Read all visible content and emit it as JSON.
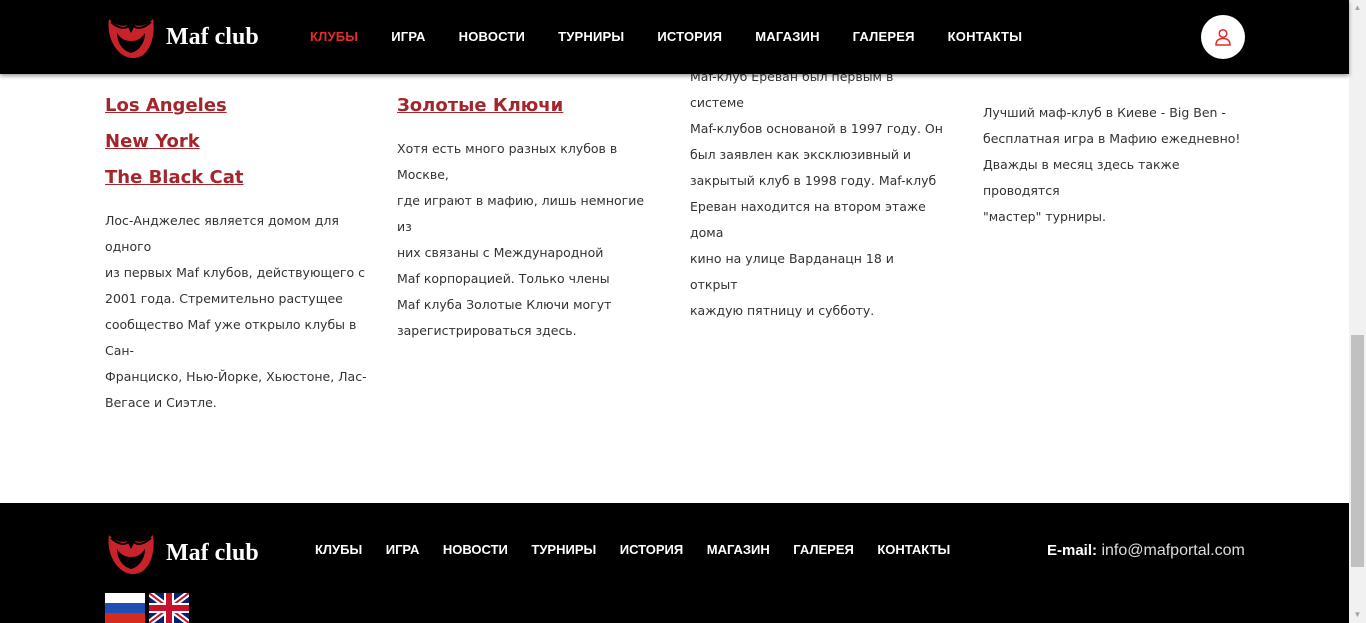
{
  "header": {
    "brand": "Maf club",
    "nav": [
      "КЛУБЫ",
      "ИГРА",
      "НОВОСТИ",
      "ТУРНИРЫ",
      "ИСТОРИЯ",
      "МАГАЗИН",
      "ГАЛЕРЕЯ",
      "КОНТАКТЫ"
    ],
    "active_nav": "КЛУБЫ"
  },
  "content": {
    "col1": {
      "links": [
        "Los Angeles",
        "New York",
        "The Black Cat"
      ],
      "desc_lines": [
        "Лос-Анджелес является домом для одного",
        "из первых Maf клубов, действующего с",
        "2001 года. Стремительно растущее",
        "сообщество Maf уже открыло клубы в Сан-",
        "Франциско, Нью-Йорке, Хьюстоне, Лас-",
        "Вегасе и Сиэтле."
      ]
    },
    "col2": {
      "title": "Золотые Ключи",
      "desc_lines": [
        "Хотя есть много разных клубов в Москве,",
        "где играют в мафию, лишь немногие из",
        "них связаны с Международной",
        "Maf корпорацией. Только члены",
        "Maf клуба Золотые Ключи могут",
        "зарегистрироваться здесь."
      ]
    },
    "col3": {
      "desc_lines": [
        "Maf-клуб Ереван был первым в системе",
        "Maf-клубов основаной в 1997 году. Он",
        "был заявлен как эксклюзивный и",
        "закрытый клуб в 1998 году. Maf-клуб",
        "Ереван находится на втором этаже дома",
        "кино на улице Варданацн 18 и открыт",
        "каждую пятницу и субботу."
      ]
    },
    "col4": {
      "desc_lines": [
        "Лучший маф-клуб в Киеве - Big Ben -",
        "бесплатная игра в Мафию ежедневно!",
        "Дважды в месяц здесь также проводятся",
        "\"мастер\" турниры."
      ]
    }
  },
  "footer": {
    "brand": "Maf club",
    "nav": [
      "КЛУБЫ",
      "ИГРА",
      "НОВОСТИ",
      "ТУРНИРЫ",
      "ИСТОРИЯ",
      "МАГАЗИН",
      "ГАЛЕРЕЯ",
      "КОНТАКТЫ"
    ],
    "email_label": "E-mail:",
    "email_value": "info@mafportal.com",
    "flags": [
      "ru-flag-icon",
      "uk-flag-icon"
    ]
  },
  "colors": {
    "accent": "#e32b2b",
    "link": "#a4262c",
    "header_bg": "#000000"
  }
}
